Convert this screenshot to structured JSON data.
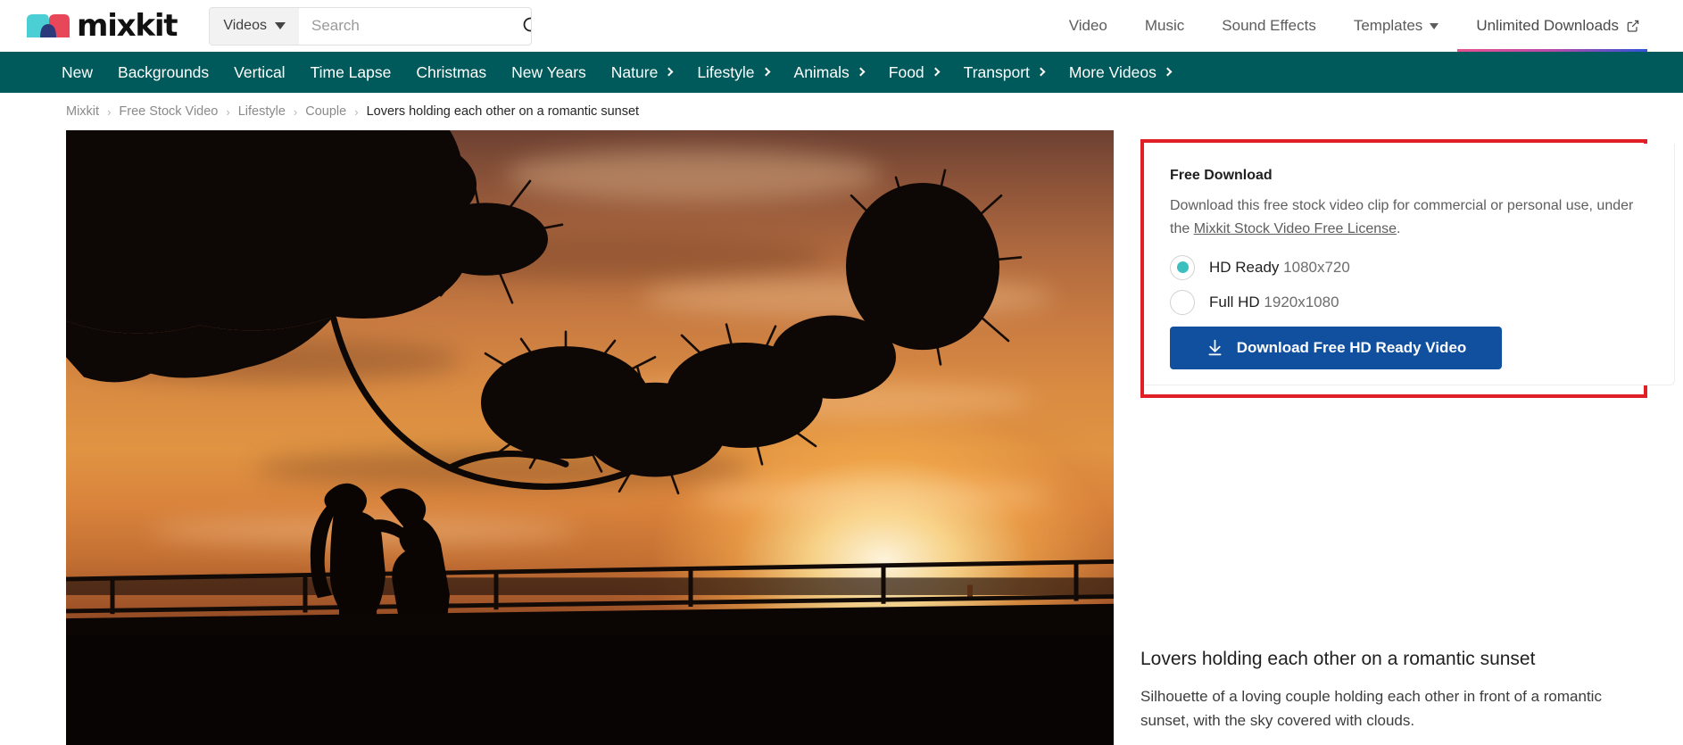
{
  "brand": {
    "name": "mixkit",
    "logo_icon": "mixkit-logo-icon",
    "colors": {
      "teal": "#4ccfd4",
      "red": "#e8475a",
      "navy": "#2b3a7a"
    }
  },
  "search": {
    "scope_label": "Videos",
    "scope_icon": "chevron-down-icon",
    "placeholder": "Search",
    "value": "",
    "submit_icon": "search-icon"
  },
  "top_nav": {
    "items": [
      {
        "label": "Video",
        "icon": "",
        "has_caret": false,
        "external": false,
        "active": false
      },
      {
        "label": "Music",
        "icon": "",
        "has_caret": false,
        "external": false,
        "active": false
      },
      {
        "label": "Sound Effects",
        "icon": "",
        "has_caret": false,
        "external": false,
        "active": false
      },
      {
        "label": "Templates",
        "icon": "chevron-down-icon",
        "has_caret": true,
        "external": false,
        "active": false
      },
      {
        "label": "Unlimited Downloads",
        "icon": "external-link-icon",
        "has_caret": false,
        "external": true,
        "active": true
      }
    ]
  },
  "category_nav": {
    "background": "#00595a",
    "items": [
      {
        "label": "New",
        "has_chevron": false
      },
      {
        "label": "Backgrounds",
        "has_chevron": false
      },
      {
        "label": "Vertical",
        "has_chevron": false
      },
      {
        "label": "Time Lapse",
        "has_chevron": false
      },
      {
        "label": "Christmas",
        "has_chevron": false
      },
      {
        "label": "New Years",
        "has_chevron": false
      },
      {
        "label": "Nature",
        "has_chevron": true
      },
      {
        "label": "Lifestyle",
        "has_chevron": true
      },
      {
        "label": "Animals",
        "has_chevron": true
      },
      {
        "label": "Food",
        "has_chevron": true
      },
      {
        "label": "Transport",
        "has_chevron": true
      },
      {
        "label": "More Videos",
        "has_chevron": true
      }
    ]
  },
  "breadcrumb": {
    "separator": "›",
    "items": [
      {
        "label": "Mixkit",
        "current": false
      },
      {
        "label": "Free Stock Video",
        "current": false
      },
      {
        "label": "Lifestyle",
        "current": false
      },
      {
        "label": "Couple",
        "current": false
      },
      {
        "label": "Lovers holding each other on a romantic sunset",
        "current": true
      }
    ]
  },
  "video": {
    "alt": "Silhouette of a couple embracing on a pier railing in front of an orange sunset with a pine branch in the upper left"
  },
  "download_panel": {
    "highlight_color": "#e01f26",
    "title": "Free Download",
    "description_before_link": "Download this free stock video clip for commercial or personal use, under the ",
    "license_link_text": "Mixkit Stock Video Free License",
    "description_after_link": ".",
    "options": [
      {
        "name": "HD Ready",
        "resolution": "1080x720",
        "selected": true
      },
      {
        "name": "Full HD",
        "resolution": "1920x1080",
        "selected": false
      }
    ],
    "button": {
      "label": "Download Free HD Ready Video",
      "icon": "download-icon",
      "color": "#11509e"
    }
  },
  "clip_info": {
    "title": "Lovers holding each other on a romantic sunset",
    "description": "Silhouette of a loving couple holding each other in front of a romantic sunset, with the sky covered with clouds."
  }
}
